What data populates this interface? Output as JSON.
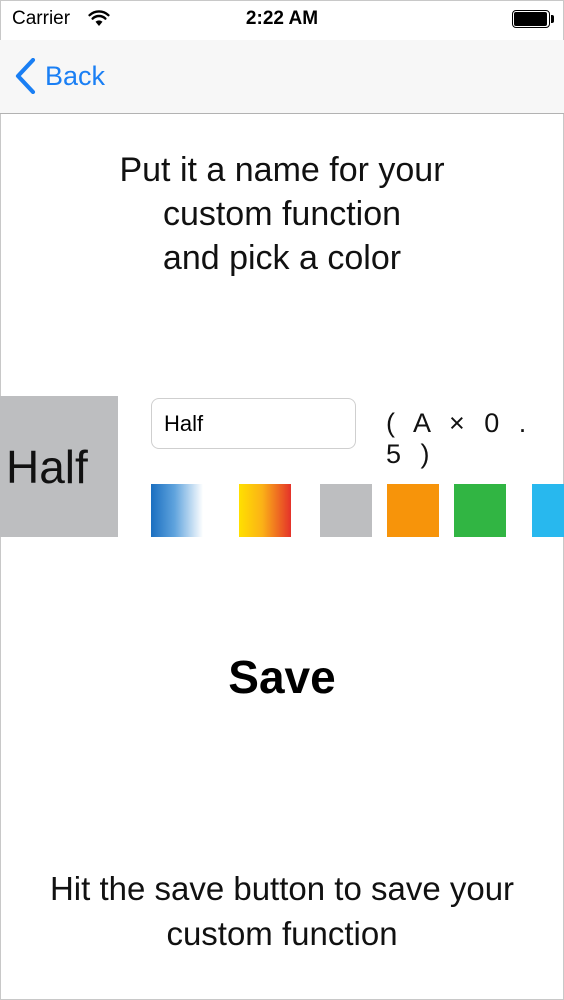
{
  "status_bar": {
    "carrier": "Carrier",
    "time": "2:22 AM",
    "wifi_icon": "wifi-icon",
    "battery_icon": "battery-icon"
  },
  "nav": {
    "back_label": "Back",
    "back_icon": "chevron-left-icon",
    "accent_color": "#1a7ff4"
  },
  "instructions": {
    "lines": [
      "Put it a name for your",
      "custom function",
      "and pick a color"
    ]
  },
  "preview": {
    "label": "Half",
    "color": "#bdbec0"
  },
  "name_field": {
    "value": "Half"
  },
  "formula": "( A × 0 . 5 )",
  "swatches": [
    {
      "name": "blue-gradient",
      "background": "linear-gradient(90deg, #1b6fc0 0%, #5fa3dd 45%, #ffffff 100%)"
    },
    {
      "name": "yellow-red-gradient",
      "background": "linear-gradient(90deg, #ffe000 0%, #fbb117 45%, #e4322a 100%)"
    },
    {
      "name": "gray",
      "background": "#bdbec0"
    },
    {
      "name": "orange",
      "background": "#f7940a"
    },
    {
      "name": "green",
      "background": "#31b543"
    },
    {
      "name": "light-blue",
      "background": "#28b8ee"
    }
  ],
  "save_label": "Save",
  "hint": {
    "lines": [
      "Hit the save button to save your",
      "custom function"
    ]
  }
}
